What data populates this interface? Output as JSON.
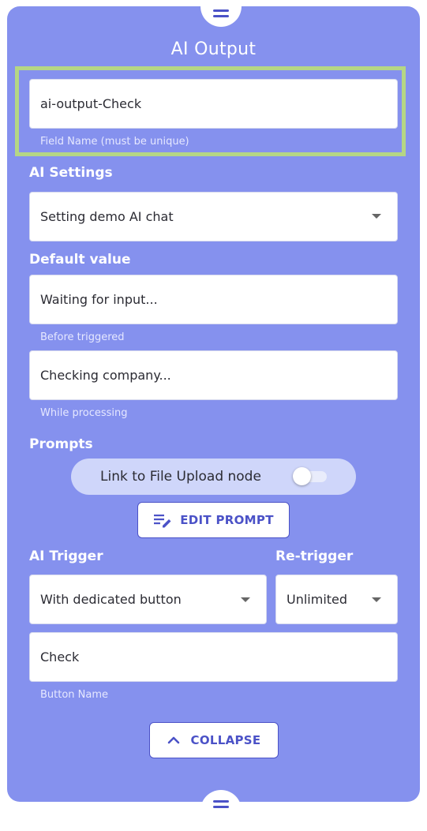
{
  "panel": {
    "title": "AI Output"
  },
  "field_name": {
    "value": "ai-output-Check",
    "helper": "Field Name (must be unique)"
  },
  "ai_settings": {
    "label": "AI Settings",
    "selected": "Setting demo AI chat"
  },
  "default_value": {
    "label": "Default value",
    "before_value": "Waiting for input...",
    "before_helper": "Before triggered",
    "processing_value": "Checking company...",
    "processing_helper": "While processing"
  },
  "prompts": {
    "label": "Prompts",
    "toggle_label": "Link to File Upload node",
    "toggle_on": false,
    "edit_button": "EDIT PROMPT",
    "edit_icon": "edit-list-icon"
  },
  "trigger": {
    "label": "AI Trigger",
    "selected": "With dedicated button",
    "retrigger_label": "Re-trigger",
    "retrigger_selected": "Unlimited"
  },
  "button_name": {
    "value": "Check",
    "helper": "Button Name"
  },
  "collapse": {
    "label": "COLLAPSE",
    "icon": "chevron-up-icon"
  },
  "colors": {
    "panel": "#8591ee",
    "accent": "#4b52c7",
    "highlight": "#b5d685"
  }
}
